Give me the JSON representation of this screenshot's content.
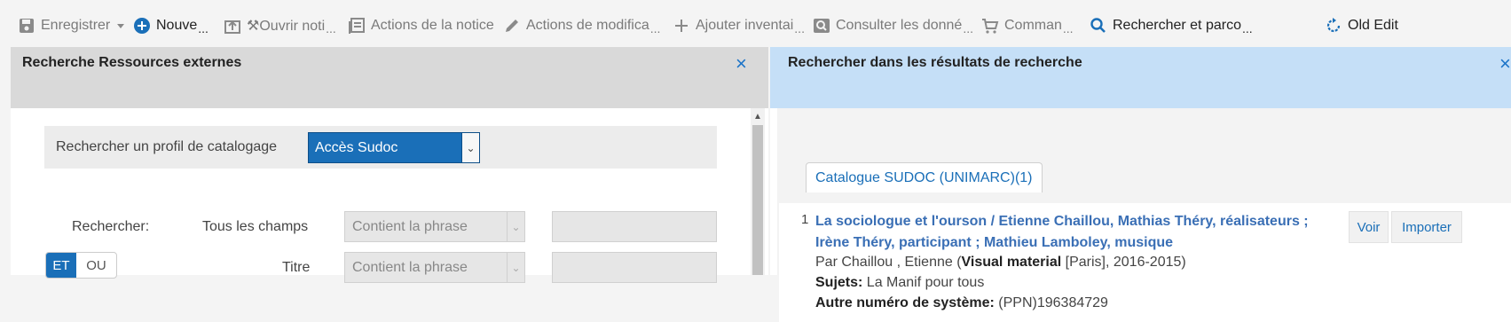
{
  "toolbar": {
    "items": [
      {
        "label": "Enregistrer",
        "dots": "",
        "icon": "save-icon"
      },
      {
        "label": "Nouve",
        "dots": "...",
        "icon": "plus-circle-icon"
      },
      {
        "label": "⚒Ouvrir noti",
        "dots": "...",
        "icon": "open-notice-icon"
      },
      {
        "label": "Actions de la notice",
        "dots": "",
        "icon": "list-icon"
      },
      {
        "label": "Actions de modifica",
        "dots": "...",
        "icon": "pencil-icon"
      },
      {
        "label": "Ajouter inventai",
        "dots": "...",
        "icon": "plus-icon"
      },
      {
        "label": "Consulter les donné",
        "dots": "...",
        "icon": "search-box-icon"
      },
      {
        "label": "Comman",
        "dots": "...",
        "icon": "cart-icon"
      },
      {
        "label": "Rechercher et parco",
        "dots": "...",
        "icon": "search-icon"
      },
      {
        "label": "Old Edit",
        "dots": "",
        "icon": "refresh-icon"
      }
    ]
  },
  "left": {
    "title": "Recherche Ressources externes",
    "close": "×",
    "profile_label": "Rechercher un profil de catalogage",
    "profile_value": "Accès Sudoc",
    "search_label": "Rechercher:",
    "rows": [
      {
        "field": "Tous les champs",
        "operator": "Contient la phrase"
      },
      {
        "field": "Titre",
        "operator": "Contient la phrase"
      }
    ],
    "toggle_et": "ET",
    "toggle_ou": "OU"
  },
  "right": {
    "title": "Rechercher dans les résultats de recherche",
    "close": "×",
    "tab": "Catalogue SUDOC (UNIMARC)(1)",
    "result": {
      "number": "1",
      "title": "La sociologue et l'ourson / Etienne Chaillou, Mathias Théry, réalisateurs ; Irène Théry, participant ; Mathieu Lamboley, musique",
      "by_prefix": "Par Chaillou , Etienne (",
      "material": "Visual material",
      "by_suffix": " [Paris], 2016-2015)",
      "subjects_label": "Sujets:",
      "subjects_value": " La Manif pour tous",
      "other_label": "Autre numéro de système:",
      "other_value": " (PPN)196384729",
      "view_button": "Voir",
      "import_button": "Importer"
    }
  }
}
